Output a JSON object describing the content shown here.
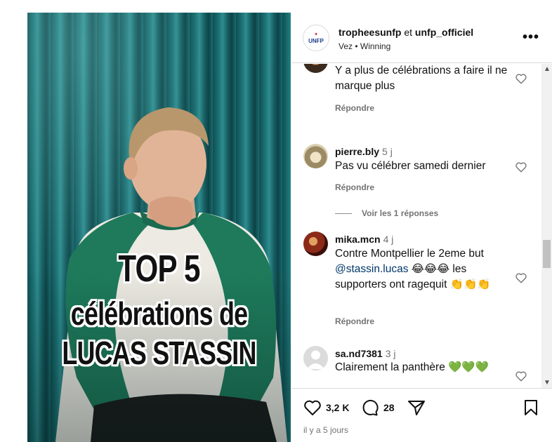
{
  "post": {
    "overlay": {
      "line1": "TOP 5",
      "line2": "célébrations de",
      "line3": "LUCAS STASSIN"
    },
    "header": {
      "logo_text": "UNFP",
      "user1": "tropheesunfp",
      "and_word": "et",
      "user2": "unfp_officiel",
      "audio": "Vez • Winning",
      "more_icon": "more-horizontal-icon"
    },
    "comments": [
      {
        "text": "Y a plus de célébrations a faire il ne marque plus",
        "reply_label": "Répondre"
      },
      {
        "username": "pierre.bly",
        "time": "5 j",
        "text": "Pas vu célébrer samedi dernier",
        "reply_label": "Répondre",
        "view_replies": "Voir les 1 réponses"
      },
      {
        "username": "mika.mcn",
        "time": "4 j",
        "text_before": "Contre Montpellier le 2eme but ",
        "mention": "@stassin.lucas",
        "text_after": " 😂😂😂 les supporters ont ragequit 👏👏👏",
        "reply_label": "Répondre"
      },
      {
        "username": "sa.nd7381",
        "time": "3 j",
        "text": "Clairement la panthère 💚💚💚"
      }
    ],
    "actions": {
      "likes": "3,2 K",
      "comments": "28"
    },
    "posted": "il y a 5 jours"
  }
}
